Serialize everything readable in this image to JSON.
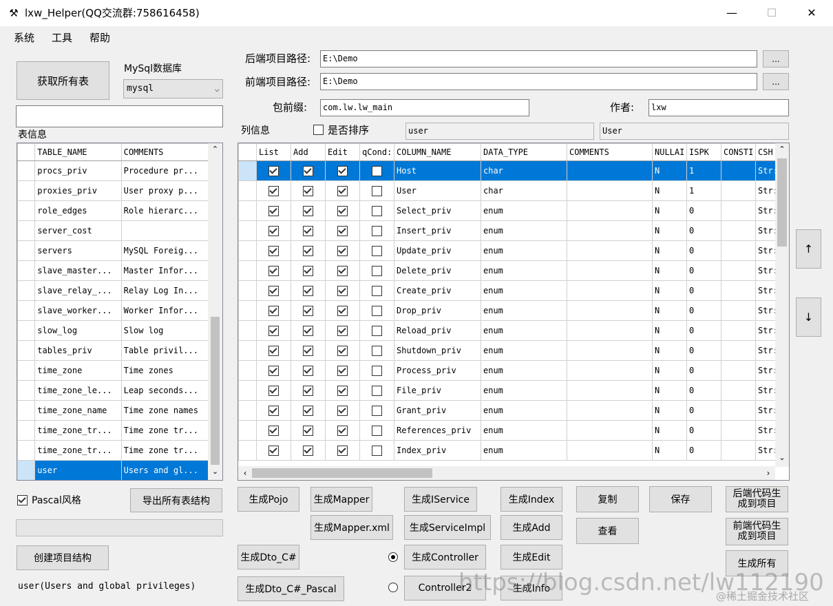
{
  "window": {
    "title": "lxw_Helper(QQ交流群:758616458)",
    "minimize": "—",
    "maximize": "☐",
    "close": "✕"
  },
  "menu": [
    "系统",
    "工具",
    "帮助"
  ],
  "left": {
    "get_tables_button": "获取所有表",
    "db_label": "MySql数据库",
    "db_selected": "mysql",
    "search_value": "",
    "table_info_label": "表信息",
    "table_headers": [
      "TABLE_NAME",
      "COMMENTS"
    ],
    "tables": [
      [
        "procs_priv",
        "Procedure pr..."
      ],
      [
        "proxies_priv",
        "User proxy p..."
      ],
      [
        "role_edges",
        "Role hierarc..."
      ],
      [
        "server_cost",
        ""
      ],
      [
        "servers",
        "MySQL Foreig..."
      ],
      [
        "slave_master...",
        "Master Infor..."
      ],
      [
        "slave_relay_...",
        "Relay Log In..."
      ],
      [
        "slave_worker...",
        "Worker Infor..."
      ],
      [
        "slow_log",
        "Slow log"
      ],
      [
        "tables_priv",
        "Table privil..."
      ],
      [
        "time_zone",
        "Time zones"
      ],
      [
        "time_zone_le...",
        "Leap seconds..."
      ],
      [
        "time_zone_name",
        "Time zone names"
      ],
      [
        "time_zone_tr...",
        "Time zone tr..."
      ],
      [
        "time_zone_tr...",
        "Time zone tr..."
      ],
      [
        "user",
        "Users and gl..."
      ]
    ],
    "pascal_label": "Pascal风格",
    "pascal_checked": true,
    "export_button": "导出所有表结构",
    "create_structure_button": "创建项目结构",
    "status_text": "user(Users and global privileges)"
  },
  "paths": {
    "backend_label": "后端项目路径:",
    "backend_value": "E:\\Demo",
    "frontend_label": "前端项目路径:",
    "frontend_value": "E:\\Demo",
    "browse": "...",
    "package_label": "包前缀:",
    "package_value": "com.lw.lw_main",
    "author_label": "作者:",
    "author_value": "lxw"
  },
  "columns": {
    "label": "列信息",
    "sort_label": "是否排序",
    "sort_checked": false,
    "table_name_value": "user",
    "entity_name_value": "User",
    "headers": [
      "List",
      "Add",
      "Edit",
      "qCond:",
      "COLUMN_NAME",
      "DATA_TYPE",
      "COMMENTS",
      "NULLAI",
      "ISPK",
      "CONSTI",
      "CSH"
    ],
    "rows": [
      [
        "Host",
        "char",
        "",
        "N",
        "1",
        "",
        "Str:"
      ],
      [
        "User",
        "char",
        "",
        "N",
        "1",
        "",
        "Str:"
      ],
      [
        "Select_priv",
        "enum",
        "",
        "N",
        "0",
        "",
        "Str:"
      ],
      [
        "Insert_priv",
        "enum",
        "",
        "N",
        "0",
        "",
        "Str:"
      ],
      [
        "Update_priv",
        "enum",
        "",
        "N",
        "0",
        "",
        "Str:"
      ],
      [
        "Delete_priv",
        "enum",
        "",
        "N",
        "0",
        "",
        "Str:"
      ],
      [
        "Create_priv",
        "enum",
        "",
        "N",
        "0",
        "",
        "Str:"
      ],
      [
        "Drop_priv",
        "enum",
        "",
        "N",
        "0",
        "",
        "Str:"
      ],
      [
        "Reload_priv",
        "enum",
        "",
        "N",
        "0",
        "",
        "Str:"
      ],
      [
        "Shutdown_priv",
        "enum",
        "",
        "N",
        "0",
        "",
        "Str:"
      ],
      [
        "Process_priv",
        "enum",
        "",
        "N",
        "0",
        "",
        "Str:"
      ],
      [
        "File_priv",
        "enum",
        "",
        "N",
        "0",
        "",
        "Str:"
      ],
      [
        "Grant_priv",
        "enum",
        "",
        "N",
        "0",
        "",
        "Str:"
      ],
      [
        "References_priv",
        "enum",
        "",
        "N",
        "0",
        "",
        "Str:"
      ],
      [
        "Index_priv",
        "enum",
        "",
        "N",
        "0",
        "",
        "Str:"
      ]
    ],
    "up": "↑",
    "down": "↓"
  },
  "buttons": {
    "pojo": "生成Pojo",
    "mapper": "生成Mapper",
    "iservice": "生成IService",
    "index": "生成Index",
    "copy": "复制",
    "save": "保存",
    "backend_gen": "后端代码生成到项目",
    "mapper_xml": "生成Mapper.xml",
    "serviceimpl": "生成ServiceImpl",
    "add": "生成Add",
    "view": "查看",
    "frontend_gen": "前端代码生成到项目",
    "dto_cs": "生成Dto_C#",
    "controller": "生成Controller",
    "edit": "生成Edit",
    "gen_all": "生成所有",
    "dto_cs_pascal": "生成Dto_C#_Pascal",
    "controller2": "Controller2",
    "info": "生成Info"
  },
  "radio": {
    "first_checked": true
  },
  "watermark": {
    "url": "https://blog.csdn.net/lw112190",
    "community": "@稀土掘金技术社区"
  }
}
